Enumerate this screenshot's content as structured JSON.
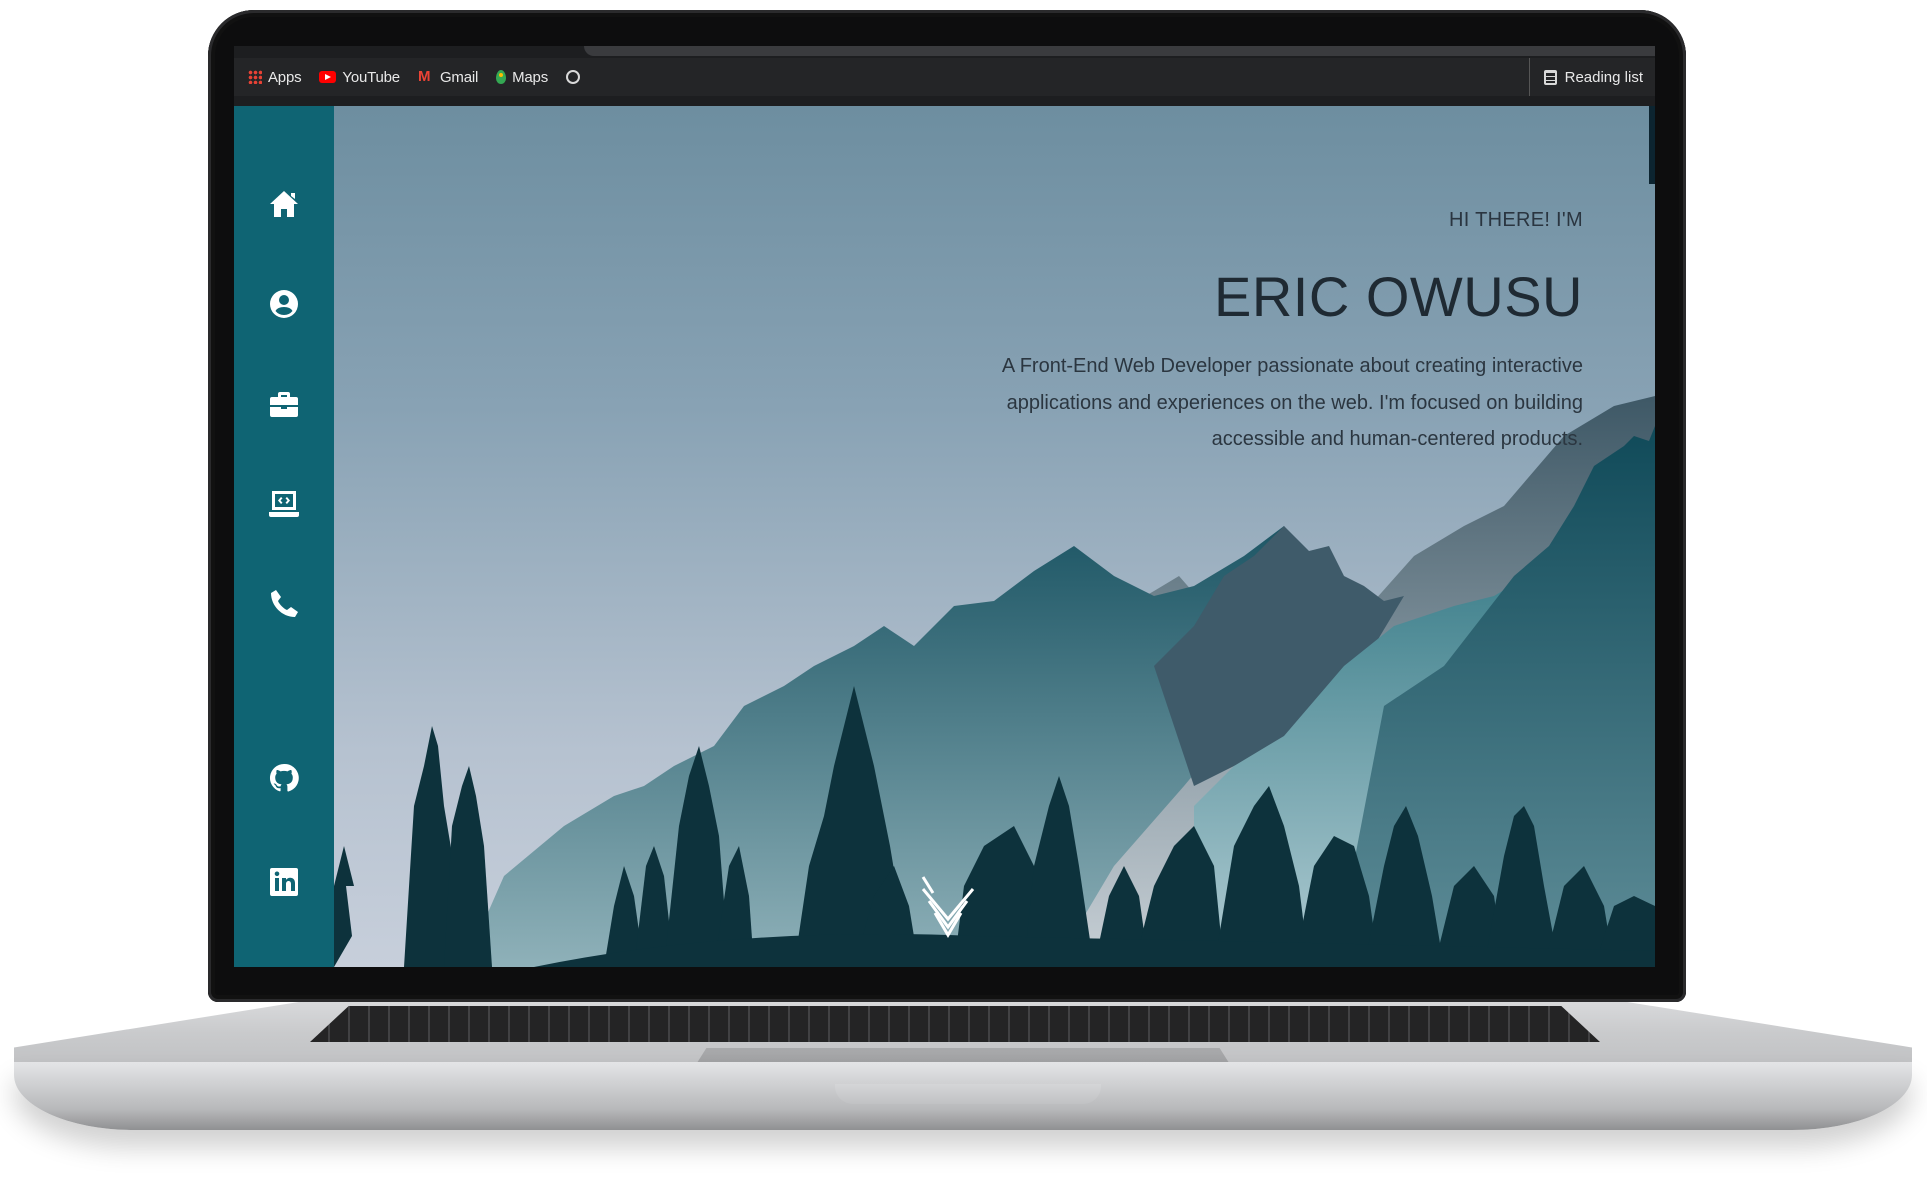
{
  "bookmarks_bar": {
    "items": [
      {
        "label": "Apps",
        "icon": "apps-grid-icon"
      },
      {
        "label": "YouTube",
        "icon": "youtube-icon"
      },
      {
        "label": "Gmail",
        "icon": "gmail-icon"
      },
      {
        "label": "Maps",
        "icon": "maps-icon"
      }
    ],
    "extra_icon": "globe-icon",
    "reading_list": "Reading list"
  },
  "sidebar": {
    "nav": [
      {
        "name": "home",
        "icon": "home-icon"
      },
      {
        "name": "about",
        "icon": "user-circle-icon"
      },
      {
        "name": "experience",
        "icon": "briefcase-icon"
      },
      {
        "name": "projects",
        "icon": "laptop-code-icon"
      },
      {
        "name": "contact",
        "icon": "phone-icon"
      }
    ],
    "social": [
      {
        "name": "github",
        "icon": "github-icon"
      },
      {
        "name": "linkedin",
        "icon": "linkedin-icon"
      }
    ],
    "color": "#0f6473"
  },
  "hero": {
    "greeting": "HI THERE! I'M",
    "name": "ERIC OWUSU",
    "bio": "A Front-End Web Developer passionate about creating interactive applications and experiences on the web. I'm focused on building accessible and human-centered products.",
    "scroll_icon": "chevron-down-icon"
  }
}
